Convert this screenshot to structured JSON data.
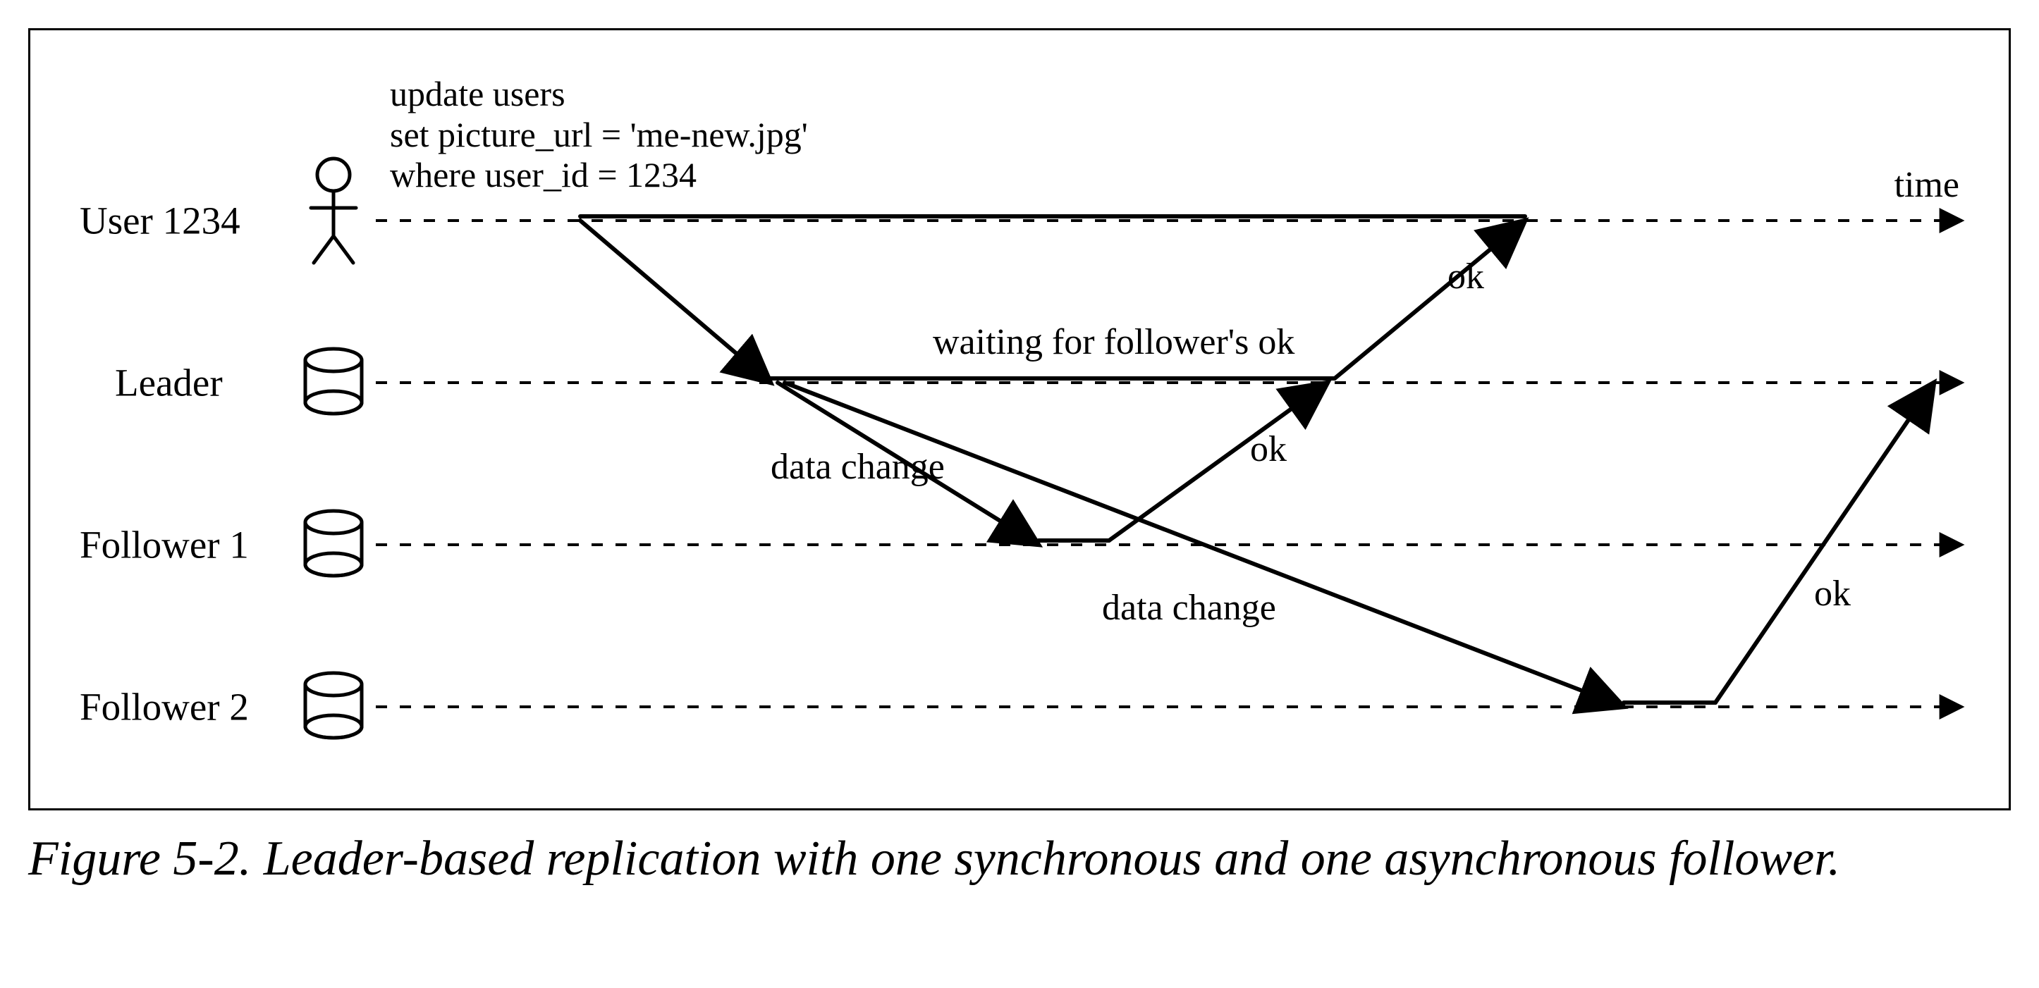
{
  "rows": {
    "user": {
      "label": "User 1234"
    },
    "leader": {
      "label": "Leader"
    },
    "follower1": {
      "label": "Follower 1"
    },
    "follower2": {
      "label": "Follower 2"
    }
  },
  "time_label": "time",
  "update_query": "update users\nset picture_url = 'me-new.jpg'\nwhere user_id = 1234",
  "annotations": {
    "waiting": "waiting for follower's ok",
    "ok_to_user": "ok",
    "data_change_1": "data change",
    "ok_from_f1": "ok",
    "data_change_2": "data change",
    "ok_from_f2": "ok"
  },
  "caption": "Figure 5-2. Leader-based replication with one synchronous and one asynchronous fol­lower."
}
